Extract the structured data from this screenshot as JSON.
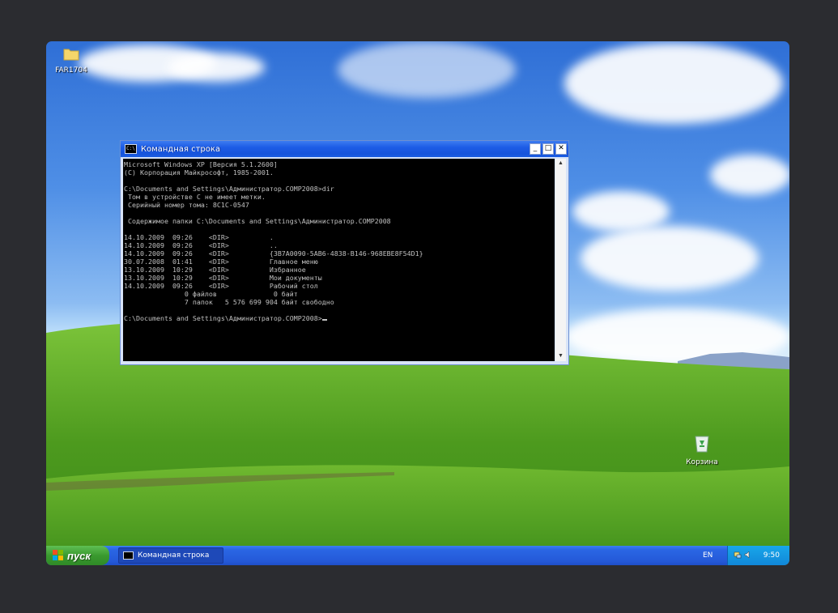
{
  "desktop": {
    "icons": [
      {
        "label": "FAR1704",
        "icon": "folder-icon"
      },
      {
        "label": "Корзина",
        "icon": "recycle-bin-icon"
      }
    ]
  },
  "cmd_window": {
    "title": "Командная строка",
    "icon": "console-icon",
    "controls": {
      "minimize": "_",
      "maximize": "□",
      "close": "✕"
    },
    "console_lines": [
      "Microsoft Windows XP [Версия 5.1.2600]",
      "(С) Корпорация Майкрософт, 1985-2001.",
      "",
      "C:\\Documents and Settings\\Администратор.COMP2008>dir",
      " Том в устройстве C не имеет метки.",
      " Серийный номер тома: 8C1C-0547",
      "",
      " Содержимое папки C:\\Documents and Settings\\Администратор.COMP2008",
      "",
      "14.10.2009  09:26    <DIR>          .",
      "14.10.2009  09:26    <DIR>          ..",
      "14.10.2009  09:26    <DIR>          {3B7A0090-5AB6-4838-B146-968EBE8F54D1}",
      "30.07.2008  01:41    <DIR>          Главное меню",
      "13.10.2009  10:29    <DIR>          Избранное",
      "13.10.2009  10:29    <DIR>          Мои документы",
      "14.10.2009  09:26    <DIR>          Рабочий стол",
      "               0 файлов              0 байт",
      "               7 папок   5 576 699 904 байт свободно",
      ""
    ],
    "prompt": "C:\\Documents and Settings\\Администратор.COMP2008>"
  },
  "taskbar": {
    "start_label": "пуск",
    "task_button_label": "Командная строка",
    "language": "EN",
    "clock": "9:50"
  },
  "colors": {
    "taskbar": "#2459d8",
    "start_button": "#3a9a2f",
    "tray": "#1187d8",
    "console_bg": "#000000",
    "console_text": "#c0c0c0"
  }
}
